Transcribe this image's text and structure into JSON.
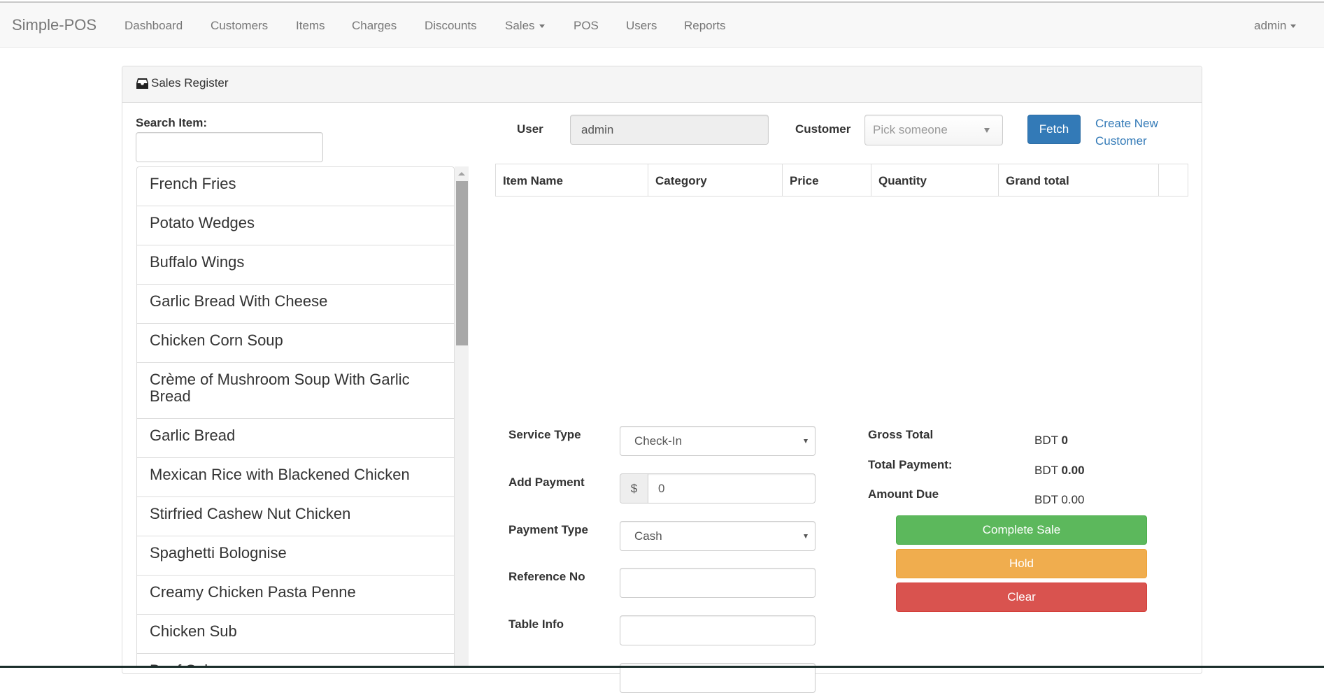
{
  "navbar": {
    "brand": "Simple-POS",
    "links": [
      "Dashboard",
      "Customers",
      "Items",
      "Charges",
      "Discounts",
      "Sales",
      "POS",
      "Users",
      "Reports"
    ],
    "user_menu": "admin"
  },
  "panel": {
    "title": "Sales Register",
    "title_icon": "inbox-icon"
  },
  "search": {
    "label": "Search Item:",
    "value": "",
    "placeholder": ""
  },
  "items": [
    "French Fries",
    "Potato Wedges",
    "Buffalo Wings",
    "Garlic Bread With Cheese",
    "Chicken Corn Soup",
    "Crème of Mushroom Soup With Garlic Bread",
    "Garlic Bread",
    "Mexican Rice with Blackened Chicken",
    "Stirfried Cashew Nut Chicken",
    "Spaghetti Bolognise",
    "Creamy Chicken Pasta Penne",
    "Chicken Sub",
    "Beef Sub"
  ],
  "header_form": {
    "user_label": "User",
    "user_value": "admin",
    "customer_label": "Customer",
    "customer_placeholder": "Pick someone",
    "fetch_label": "Fetch",
    "create_customer_label": "Create New Customer"
  },
  "cart_table": {
    "columns": [
      "Item Name",
      "Category",
      "Price",
      "Quantity",
      "Grand total",
      ""
    ],
    "rows": []
  },
  "order_form": {
    "service_type_label": "Service Type",
    "service_type_value": "Check-In",
    "add_payment_label": "Add Payment",
    "currency_addon": "$",
    "add_payment_value": "0",
    "payment_type_label": "Payment Type",
    "payment_type_value": "Cash",
    "reference_label": "Reference No",
    "reference_value": "",
    "table_info_label": "Table Info",
    "table_info_value": ""
  },
  "summary": {
    "gross_total_label": "Gross Total",
    "gross_total_currency": "BDT",
    "gross_total_value": "0",
    "total_payment_label": "Total Payment:",
    "total_payment_currency": "BDT",
    "total_payment_value": "0.00",
    "amount_due_label": "Amount Due",
    "amount_due_value": "BDT 0.00"
  },
  "actions": {
    "complete_label": "Complete Sale",
    "hold_label": "Hold",
    "clear_label": "Clear"
  },
  "colors": {
    "primary": "#337ab7",
    "success": "#5cb85c",
    "warning": "#f0ad4e",
    "danger": "#d9534f"
  }
}
